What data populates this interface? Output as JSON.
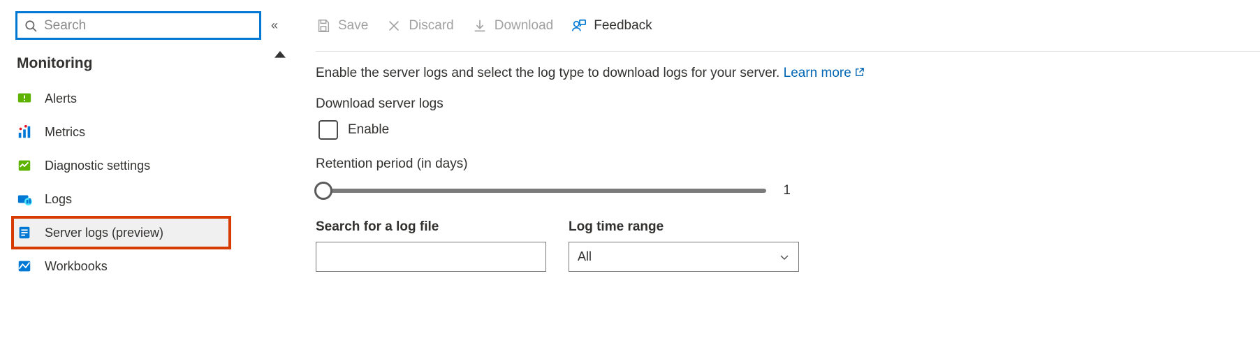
{
  "sidebar": {
    "search_placeholder": "Search",
    "section_title": "Monitoring",
    "items": [
      {
        "label": "Alerts"
      },
      {
        "label": "Metrics"
      },
      {
        "label": "Diagnostic settings"
      },
      {
        "label": "Logs"
      },
      {
        "label": "Server logs (preview)"
      },
      {
        "label": "Workbooks"
      }
    ]
  },
  "toolbar": {
    "save_label": "Save",
    "discard_label": "Discard",
    "download_label": "Download",
    "feedback_label": "Feedback"
  },
  "main": {
    "intro_text": "Enable the server logs and select the log type to download logs for your server. ",
    "learn_more_label": "Learn more",
    "download_heading": "Download server logs",
    "enable_label": "Enable",
    "retention_label": "Retention period (in days)",
    "retention_value": "1",
    "search_label": "Search for a log file",
    "search_value": "",
    "timerange_label": "Log time range",
    "timerange_value": "All"
  }
}
